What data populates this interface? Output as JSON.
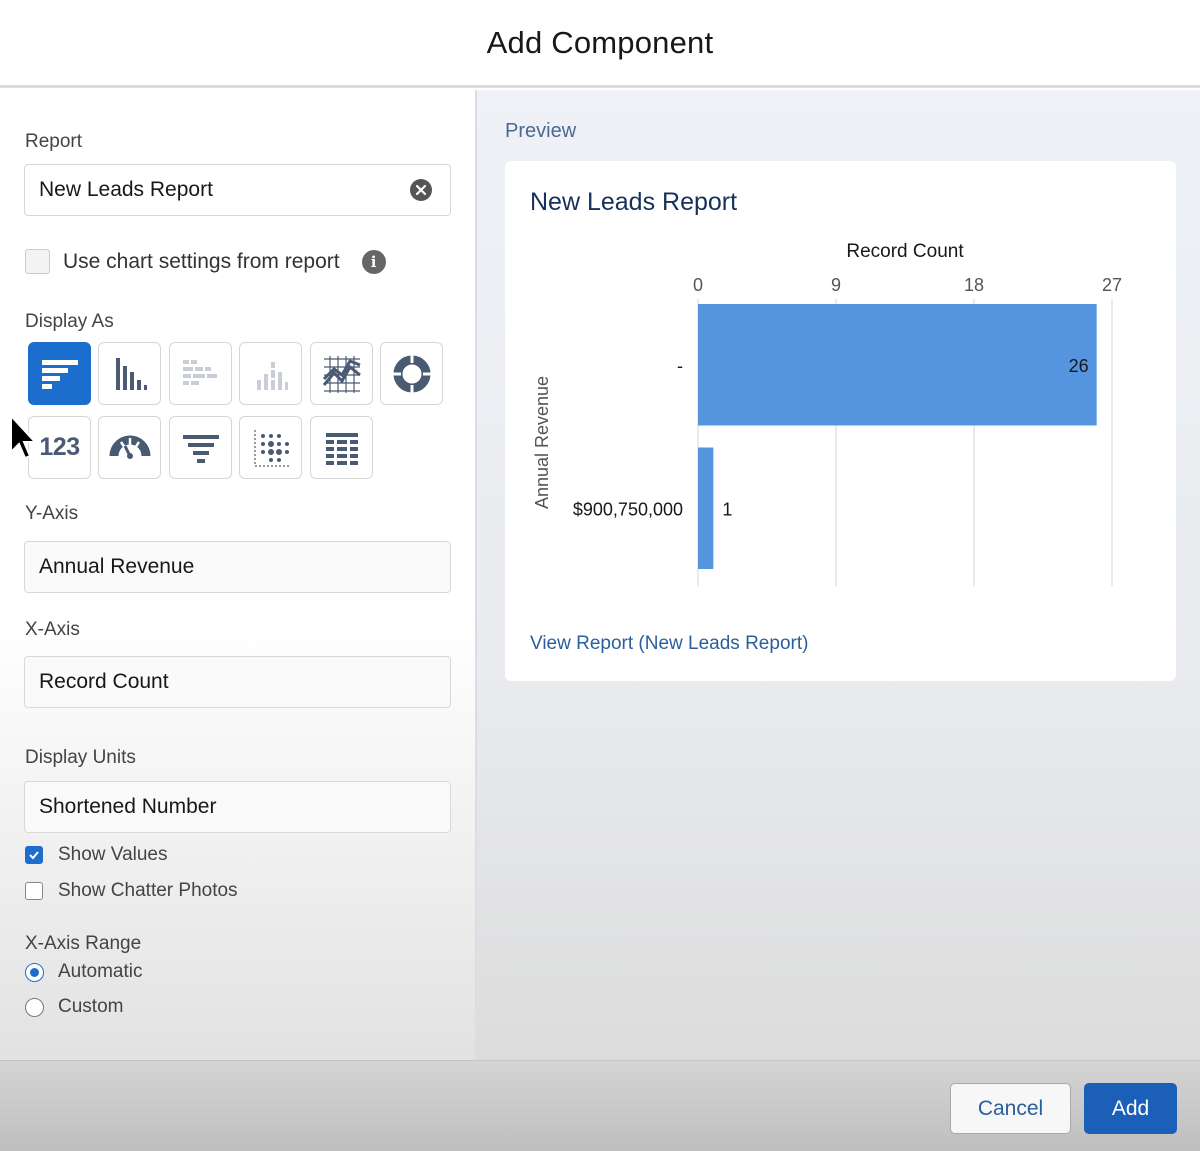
{
  "header": {
    "title": "Add Component"
  },
  "form": {
    "report_label": "Report",
    "report_value": "New Leads Report",
    "use_chart_settings_label": "Use chart settings from report",
    "display_as_label": "Display As",
    "chart_types": [
      {
        "icon": "horizontal-bar-chart-icon",
        "selected": true
      },
      {
        "icon": "vertical-bar-chart-icon",
        "selected": false
      },
      {
        "icon": "stacked-horizontal-bar-icon",
        "selected": false
      },
      {
        "icon": "stacked-vertical-bar-icon",
        "selected": false
      },
      {
        "icon": "line-chart-icon",
        "selected": false
      },
      {
        "icon": "donut-chart-icon",
        "selected": false
      },
      {
        "icon": "metric-icon",
        "selected": false
      },
      {
        "icon": "gauge-icon",
        "selected": false
      },
      {
        "icon": "funnel-icon",
        "selected": false
      },
      {
        "icon": "scatter-plot-icon",
        "selected": false
      },
      {
        "icon": "table-icon",
        "selected": false
      }
    ],
    "metric_icon_text": "123",
    "y_axis_label": "Y-Axis",
    "y_axis_value": "Annual Revenue",
    "x_axis_label": "X-Axis",
    "x_axis_value": "Record Count",
    "display_units_label": "Display Units",
    "display_units_value": "Shortened Number",
    "show_values_label": "Show Values",
    "show_values_checked": true,
    "show_chatter_photos_label": "Show Chatter Photos",
    "show_chatter_photos_checked": false,
    "x_axis_range_label": "X-Axis Range",
    "range_automatic_label": "Automatic",
    "range_custom_label": "Custom",
    "range_selected": "Automatic"
  },
  "preview": {
    "label": "Preview",
    "chart_title": "New Leads Report",
    "view_report_link": "View Report (New Leads Report)"
  },
  "chart_data": {
    "type": "bar",
    "orientation": "horizontal",
    "title": "New Leads Report",
    "xlabel": "Record Count",
    "ylabel": "Annual Revenue",
    "categories": [
      "-",
      "$900,750,000"
    ],
    "values": [
      26,
      1
    ],
    "data_labels": [
      "26",
      "1"
    ],
    "xlim": [
      0,
      27
    ],
    "x_ticks": [
      "0",
      "9",
      "18",
      "27"
    ],
    "grid": true,
    "bar_color": "#5595e0"
  },
  "footer": {
    "cancel_label": "Cancel",
    "add_label": "Add"
  },
  "colors": {
    "accent": "#1b6ecd",
    "link": "#2b5e9b"
  }
}
